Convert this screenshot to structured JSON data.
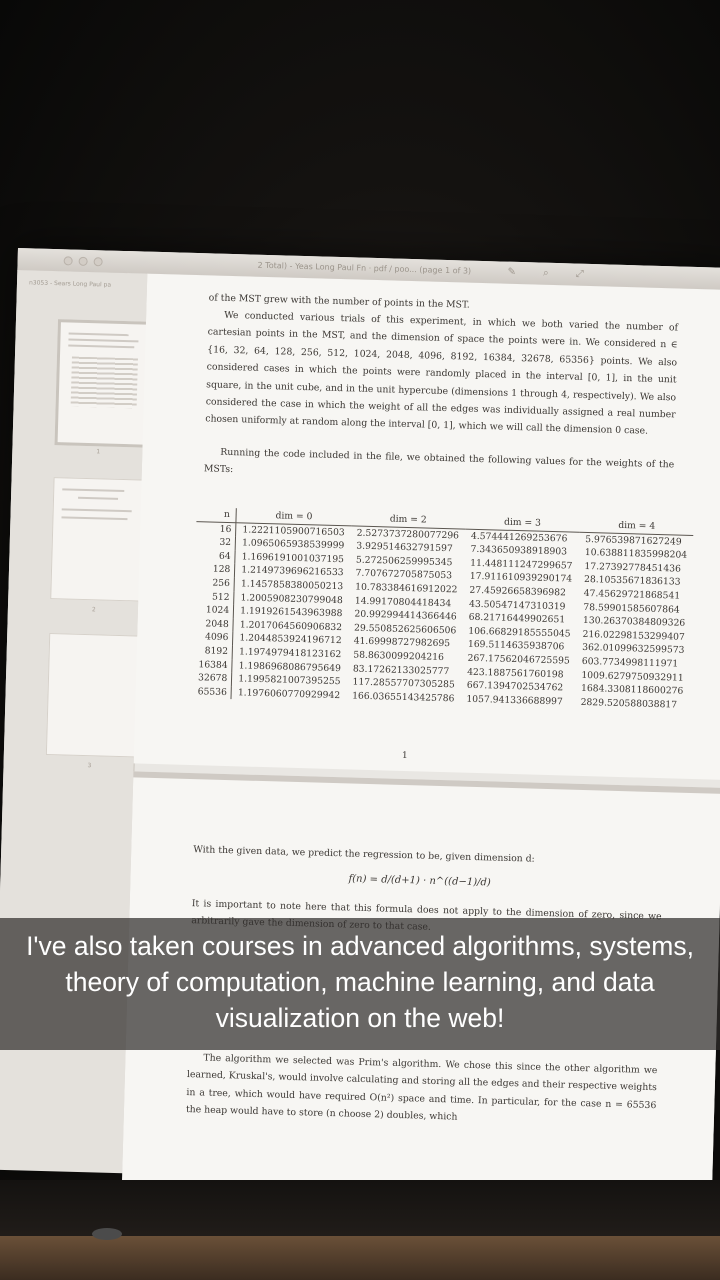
{
  "window": {
    "title": "2 Total) - Yeas Long Paul Fn · pdf / poo... (page 1 of 3)",
    "sidebar_title": "n3053 - Sears Long Paul pa"
  },
  "sidebar": {
    "page_numbers": [
      "1",
      "2",
      "3"
    ]
  },
  "page1": {
    "intro": "of the MST grew with the number of points in the MST.",
    "para1": "We conducted various trials of this experiment, in which we both varied the number of cartesian points in the MST, and the dimension of space the points were in. We considered n ∈ {16, 32, 64, 128, 256, 512, 1024, 2048, 4096, 8192, 16384, 32678, 65356} points. We also considered cases in which the points were randomly placed in the interval [0, 1], in the unit square, in the unit cube, and in the unit hypercube (dimensions 1 through 4, respectively). We also considered the case in which the weight of all the edges was individually assigned a real number chosen uniformly at random along the interval [0, 1], which we will call the dimension 0 case.",
    "para2": "Running the code included in the file, we obtained the following values for the weights of the MSTs:",
    "page_number": "1"
  },
  "table": {
    "headers": [
      "n",
      "dim = 0",
      "dim = 2",
      "dim = 3",
      "dim = 4"
    ],
    "rows": [
      [
        "16",
        "1.2221105900716503",
        "2.5273737280077296",
        "4.574441269253676",
        "5.976539871627249"
      ],
      [
        "32",
        "1.0965065938539999",
        "3.929514632791597",
        "7.343650938918903",
        "10.638811835998204"
      ],
      [
        "64",
        "1.1696191001037195",
        "5.272506259995345",
        "11.448111247299657",
        "17.27392778451436"
      ],
      [
        "128",
        "1.2149739696216533",
        "7.707672705875053",
        "17.911610939290174",
        "28.10535671836133"
      ],
      [
        "256",
        "1.1457858380050213",
        "10.783384616912022",
        "27.45926658396982",
        "47.45629721868541"
      ],
      [
        "512",
        "1.2005908230799048",
        "14.99170804418434",
        "43.50547147310319",
        "78.59901585607864"
      ],
      [
        "1024",
        "1.1919261543963988",
        "20.992994414366446",
        "68.21716449902651",
        "130.26370384809326"
      ],
      [
        "2048",
        "1.2017064560906832",
        "29.550852625606506",
        "106.66829185555045",
        "216.02298153299407"
      ],
      [
        "4096",
        "1.2044853924196712",
        "41.69998727982695",
        "169.5114635938706",
        "362.01099632599573"
      ],
      [
        "8192",
        "1.1974979418123162",
        "58.8630099204216",
        "267.17562046725595",
        "603.7734998111971"
      ],
      [
        "16384",
        "1.1986968086795649",
        "83.17262133025777",
        "423.1887561760198",
        "1009.6279750932911"
      ],
      [
        "32678",
        "1.1995821007395255",
        "117.28557707305285",
        "667.1394702534762",
        "1684.3308118600276"
      ],
      [
        "65536",
        "1.1976060770929942",
        "166.03655143425786",
        "1057.941336688997",
        "2829.520588038817"
      ]
    ]
  },
  "page2": {
    "predict": "With the given data, we predict the regression to be, given dimension d:",
    "formula": "f(n) = d/(d+1) · n^((d−1)/d)",
    "note": "It is important to note here that this formula does not apply to the dimension of zero, since we arbitrarily gave the dimension of zero to that case.",
    "algo": "The algorithm we selected was Prim's algorithm. We chose this since the other algorithm we learned, Kruskal's, would involve calculating and storing all the edges and their respective weights in a tree, which would have required O(n²) space and time. In particular, for the case n = 65536 the heap would have to store (n choose 2) doubles, which"
  },
  "caption": {
    "text": "I've also taken courses in advanced algorithms, systems, theory of computation, machine learning, and data visualization on the web!"
  }
}
